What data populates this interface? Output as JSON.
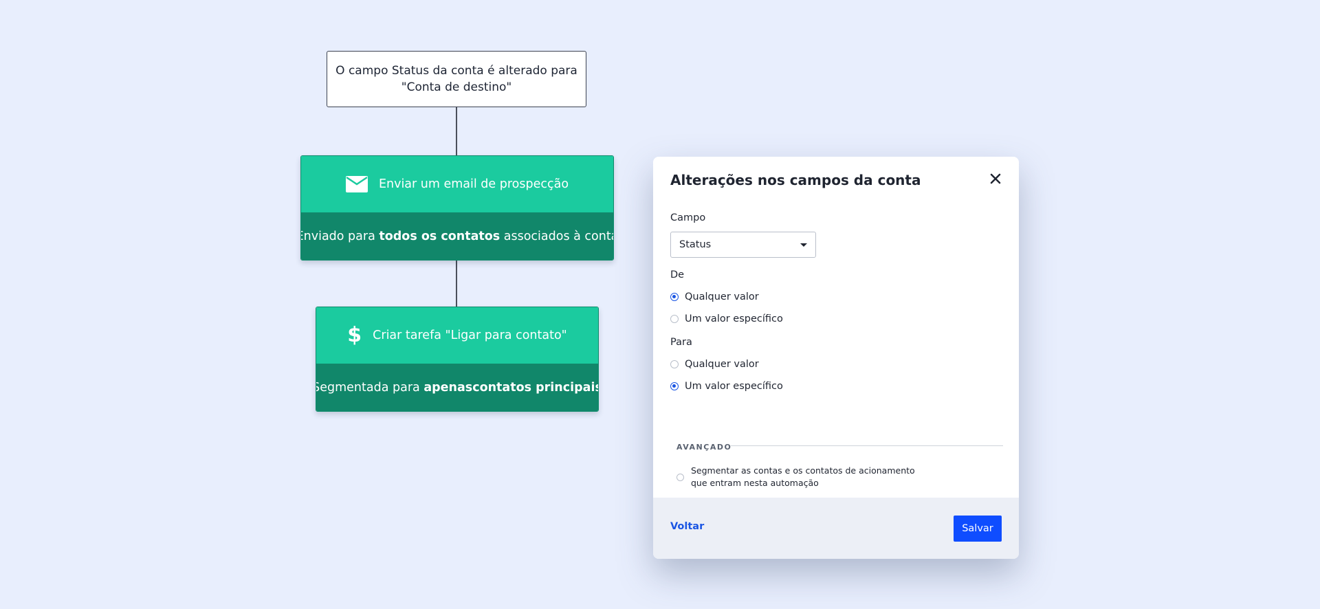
{
  "flow": {
    "trigger": {
      "line1": "O campo Status da conta é alterado para",
      "line2": "\"Conta de destino\""
    },
    "email_action": {
      "title": "Enviar um email de prospecção",
      "desc_pre": "Enviado para ",
      "desc_bold": "todos os contatos",
      "desc_post": " associados à conta"
    },
    "task_action": {
      "title": "Criar tarefa \"Ligar para contato\"",
      "desc_pre": "Segmentada para ",
      "desc_bold": "apenascontatos principais"
    }
  },
  "modal": {
    "title": "Alterações nos campos da conta",
    "campo_label": "Campo",
    "campo_value": "Status",
    "de_label": "De",
    "de_options": [
      "Qualquer valor",
      "Um valor específico"
    ],
    "de_selected": 0,
    "para_label": "Para",
    "para_options": [
      "Qualquer valor",
      "Um valor específico"
    ],
    "para_selected": 1,
    "advanced_label": "AVANÇADO",
    "advanced_option_line1": "Segmentar as contas e os contatos de acionamento",
    "advanced_option_line2": "que entram nesta automação",
    "back_label": "Voltar",
    "save_label": "Salvar"
  },
  "colors": {
    "background": "#e8eefd",
    "card_top": "#1bcb9f",
    "card_bottom": "#11876a",
    "primary": "#0f4dff",
    "radio_selected": "#1a55e3"
  },
  "icons": {
    "email": "envelope-icon",
    "task": "dollar-icon",
    "close": "close-icon"
  }
}
